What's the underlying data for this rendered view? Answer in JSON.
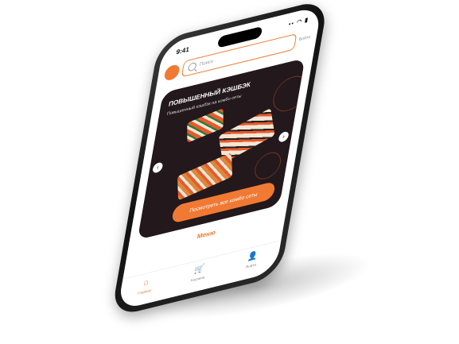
{
  "status": {
    "time": "9:41",
    "icons": "▪▪ ◠ ▮"
  },
  "header": {
    "logo_text": "",
    "search_placeholder": "Поиск",
    "right_link": "Войти"
  },
  "banner": {
    "title": "ПОВЫШЕННЫЙ КЭШБЭК",
    "subtitle": "Повышенный кэшбэк на комбо сеты",
    "button_label": "Посмотреть все комбо сеты",
    "arrow_left": "‹",
    "arrow_right": "›"
  },
  "section": {
    "title": "Меню"
  },
  "tabs": [
    {
      "label": "Главная",
      "icon": "⌂"
    },
    {
      "label": "Корзина",
      "icon": "🛒"
    },
    {
      "label": "Войти",
      "icon": "👤"
    }
  ],
  "colors": {
    "accent": "#f07a33",
    "banner_bg": "#23181c"
  }
}
